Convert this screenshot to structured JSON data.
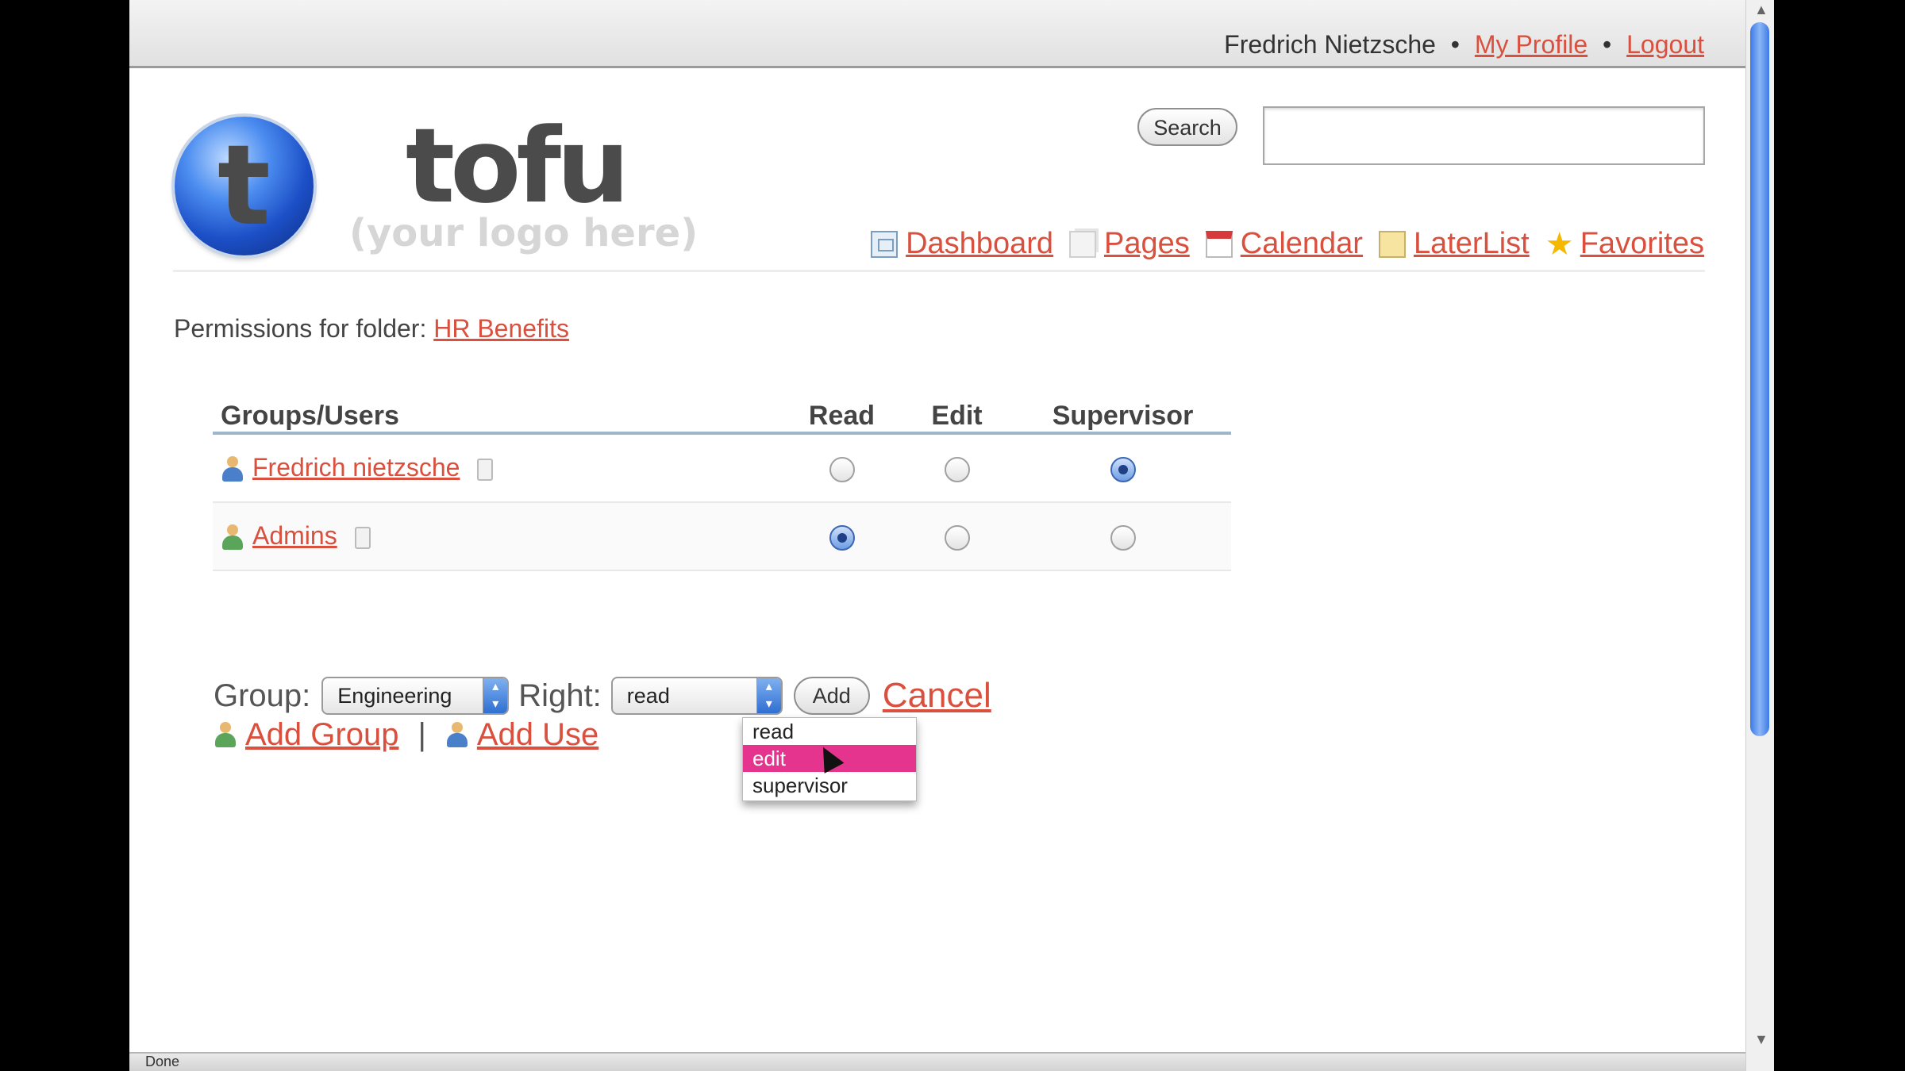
{
  "user": {
    "name": "Fredrich Nietzsche",
    "separator": "•",
    "my_profile": "My Profile",
    "logout": "Logout"
  },
  "brand": {
    "logo_letter": "t",
    "name": "tofu",
    "tagline": "(your logo here)"
  },
  "search": {
    "button": "Search",
    "value": ""
  },
  "nav": {
    "items": [
      {
        "label": "Dashboard",
        "icon": "dashboard-icon"
      },
      {
        "label": "Pages",
        "icon": "pages-icon"
      },
      {
        "label": "Calendar",
        "icon": "calendar-icon"
      },
      {
        "label": "LaterList",
        "icon": "laterlist-icon"
      },
      {
        "label": "Favorites",
        "icon": "star-icon"
      }
    ]
  },
  "permissions": {
    "prefix": "Permissions for folder:",
    "folder": "HR Benefits",
    "headers": {
      "name": "Groups/Users",
      "read": "Read",
      "edit": "Edit",
      "supervisor": "Supervisor"
    },
    "rows": [
      {
        "name": "Fredrich nietzsche",
        "type": "user",
        "right": "supervisor"
      },
      {
        "name": "Admins",
        "type": "group",
        "right": "read"
      }
    ]
  },
  "add_form": {
    "group_label": "Group:",
    "group_value": "Engineering",
    "right_label": "Right:",
    "right_value": "read",
    "add_button": "Add",
    "cancel": "Cancel",
    "add_group": "Add Group",
    "pipe": "|",
    "add_user": "Add Use"
  },
  "dropdown": {
    "options": [
      "read",
      "edit",
      "supervisor"
    ],
    "highlighted": "edit"
  },
  "status": {
    "text": "Done"
  },
  "colors": {
    "link": "#d9503f",
    "highlight": "#e4348e",
    "accent": "#3d7ae6"
  }
}
